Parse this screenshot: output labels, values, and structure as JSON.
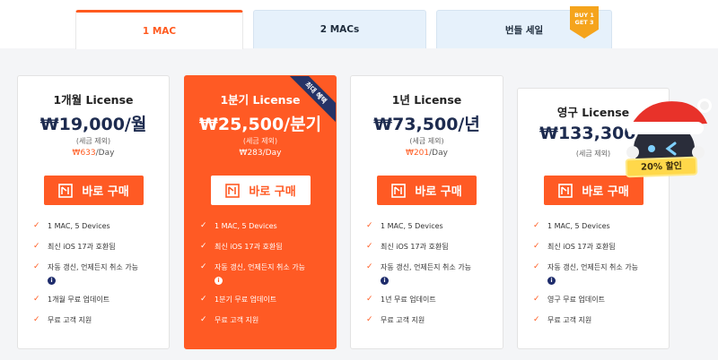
{
  "tabs": [
    {
      "label": "1 MAC"
    },
    {
      "label": "2 MACs"
    },
    {
      "label": "번들 세일"
    }
  ],
  "bundle_badge": {
    "line1": "BUY 1",
    "line2": "GET 3"
  },
  "plans": [
    {
      "title": "1개월 License",
      "price": "₩19,000/월",
      "note": "(세금 제외)",
      "day_won": "₩633",
      "day_suffix": "/Day",
      "buy_label": "바로 구매",
      "features": [
        "1 MAC, 5 Devices",
        "최신 iOS 17과 호환됨",
        "자동 갱신, 언제든지 취소 가능",
        "1개월 무료 업데이트",
        "무료 고객 지원"
      ]
    },
    {
      "title": "1분기 License",
      "price": "₩25,500/분기",
      "note": "(세금 제외)",
      "day_won": "₩283",
      "day_suffix": "/Day",
      "buy_label": "바로 구매",
      "ribbon": "최대 혜택",
      "features": [
        "1 MAC, 5 Devices",
        "최신 iOS 17과 호환됨",
        "자동 갱신, 언제든지 취소 가능",
        "1분기 무료 업데이트",
        "무료 고객 지원"
      ]
    },
    {
      "title": "1년 License",
      "price": "₩73,500/년",
      "note": "(세금 제외)",
      "day_won": "₩201",
      "day_suffix": "/Day",
      "buy_label": "바로 구매",
      "features": [
        "1 MAC, 5 Devices",
        "최신 iOS 17과 호환됨",
        "자동 갱신, 언제든지 취소 가능",
        "1년 무료 업데이트",
        "무료 고객 지원"
      ]
    },
    {
      "title": "영구 License",
      "price": "₩133,300/",
      "note": "(세금 제외)",
      "buy_label": "바로 구매",
      "features": [
        "1 MAC, 5 Devices",
        "최신 iOS 17과 호환됨",
        "자동 갱신, 언제든지 취소 가능",
        "영구 무료 업데이트",
        "무료 고객 지원"
      ]
    }
  ],
  "info_icon": "i",
  "promo": {
    "discount": "20% 할인"
  },
  "colors": {
    "accent": "#ff5a24",
    "navy": "#1d2b4f",
    "tab_bg": "#e6f1fb",
    "badge": "#f5a41c"
  }
}
